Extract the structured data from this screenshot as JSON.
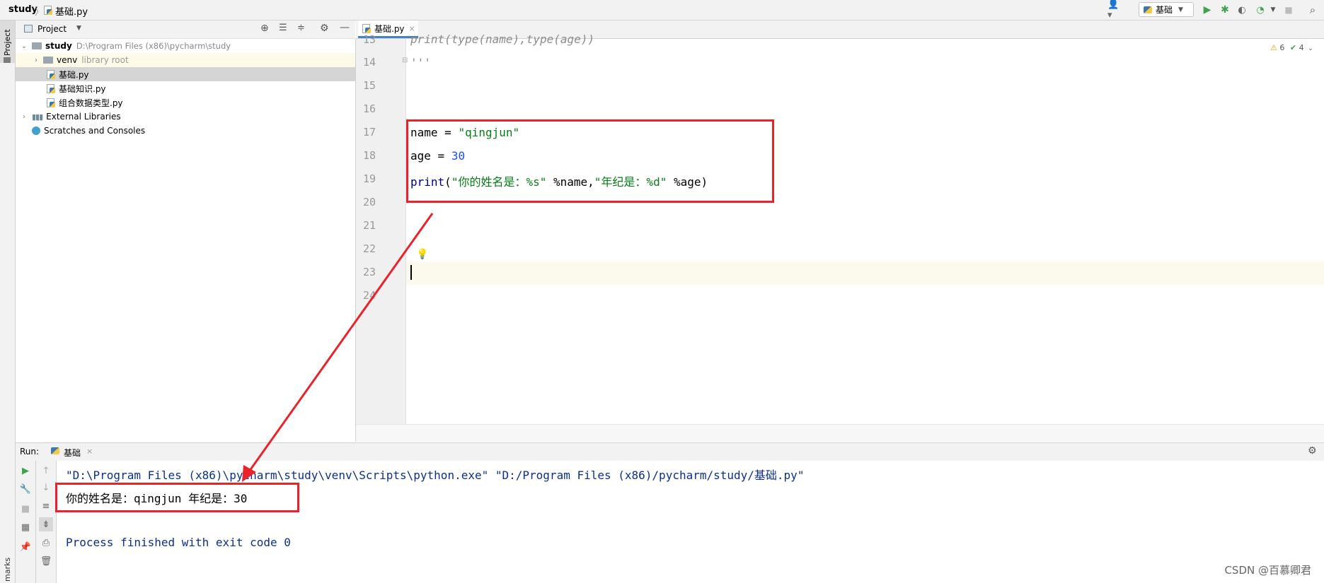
{
  "navbar": {
    "project": "study",
    "file": "基础.py",
    "run_config": "基础"
  },
  "left_stripe": {
    "project_label": "Project",
    "bookmarks_label": "marks"
  },
  "project_panel": {
    "title": "Project",
    "tree": [
      {
        "name": "study",
        "path": "D:\\Program Files (x86)\\pycharm\\study"
      },
      {
        "name": "venv",
        "hint": "library root"
      },
      {
        "name": "基础.py"
      },
      {
        "name": "基础知识.py"
      },
      {
        "name": "组合数据类型.py"
      },
      {
        "name": "External Libraries"
      },
      {
        "name": "Scratches and Consoles"
      }
    ]
  },
  "editor": {
    "tab_label": "基础.py",
    "inspections": {
      "warnings": "6",
      "ok": "4"
    },
    "line_numbers": [
      "13",
      "14",
      "15",
      "16",
      "17",
      "18",
      "19",
      "20",
      "21",
      "22",
      "23",
      "24"
    ],
    "lines": {
      "l13": "print(type(name),type(age))",
      "l14": "'''",
      "l17_name": "name",
      "l17_eq": " = ",
      "l17_val": "\"qingjun\"",
      "l18_name": "age",
      "l18_eq": " = ",
      "l18_val": "30",
      "l19_fn": "print",
      "l19_open": "(",
      "l19_str1": "\"你的姓名是：%s\"",
      "l19_mid": " %name,",
      "l19_str2": "\"年纪是：%d\"",
      "l19_end": " %age)"
    }
  },
  "run": {
    "label": "Run:",
    "tab": "基础",
    "cmd": "\"D:\\Program Files (x86)\\pycharm\\study\\venv\\Scripts\\python.exe\" \"D:/Program Files (x86)/pycharm/study/基础.py\"",
    "output": "你的姓名是：qingjun 年纪是：30",
    "exit": "Process finished with exit code 0"
  },
  "watermark": "CSDN @百慕卿君",
  "colors": {
    "accent": "#4083c9",
    "highlight_box": "#e8232a",
    "string": "#067d17",
    "number": "#1750eb",
    "run_green": "#3fa34d"
  }
}
